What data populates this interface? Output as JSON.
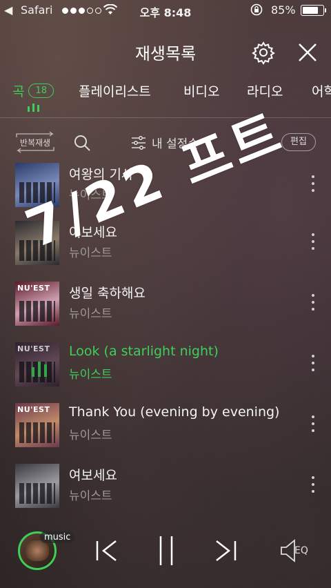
{
  "status_bar": {
    "back_app": "Safari",
    "time": "오후 8:48",
    "battery": "85%",
    "battery_level": 0.85,
    "signal_bars": 3
  },
  "header": {
    "title": "재생목록",
    "settings_icon": "gear-icon",
    "close_icon": "close-icon"
  },
  "tabs": [
    {
      "label": "곡",
      "count": "18",
      "active": true
    },
    {
      "label": "플레이리스트"
    },
    {
      "label": "비디오"
    },
    {
      "label": "라디오"
    },
    {
      "label": "어학"
    }
  ],
  "toolbar": {
    "repeat_label": "반복재생",
    "my_settings_label": "내 설정순",
    "edit_label": "편집"
  },
  "songs": [
    {
      "title": "여왕의 기사",
      "artist": "뉴이스트",
      "thumb_label": "",
      "colors": [
        "#2a3a6a",
        "#7a8ab8"
      ]
    },
    {
      "title": "여보세요",
      "artist": "뉴이스트",
      "thumb_label": "",
      "colors": [
        "#2a2a30",
        "#8a7a6a"
      ]
    },
    {
      "title": "생일 축하해요",
      "artist": "뉴이스트",
      "thumb_label": "NU'EST",
      "colors": [
        "#5a1a2a",
        "#d0a0b0"
      ]
    },
    {
      "title": "Look (a starlight night)",
      "artist": "뉴이스트",
      "thumb_label": "NU'EST",
      "colors": [
        "#3a2a3a",
        "#7a5a6a"
      ],
      "playing": true
    },
    {
      "title": "Thank You (evening by evening)",
      "artist": "뉴이스트",
      "thumb_label": "NU'EST",
      "colors": [
        "#6a3a4a",
        "#c08a6a"
      ]
    },
    {
      "title": "여보세요",
      "artist": "뉴이스트",
      "thumb_label": "",
      "colors": [
        "#3a3a40",
        "#9a9aa0"
      ]
    }
  ],
  "overlay": {
    "text": "7/22 프트"
  },
  "player": {
    "badge": "music",
    "eq_label": "EQ"
  },
  "colors": {
    "accent": "#3ecf5a",
    "text": "#f2f2f2",
    "muted": "#9e9a98"
  }
}
